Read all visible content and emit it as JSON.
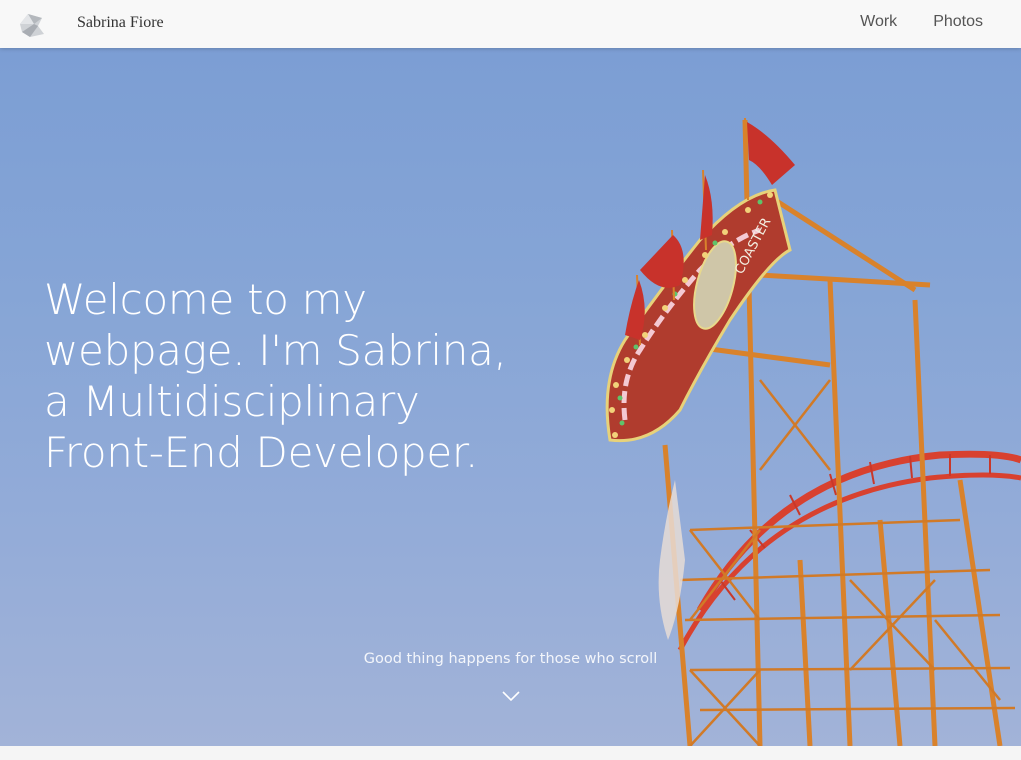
{
  "nav": {
    "brand": "Sabrina Fiore",
    "links": [
      {
        "label": "Work"
      },
      {
        "label": "Photos"
      }
    ]
  },
  "hero": {
    "headline": "Welcome to my webpage. I'm Sabrina, a Multidisciplinary Front-End Developer.",
    "scroll_hint": "Good thing happens for those who scroll",
    "sign_text": "COASTER"
  },
  "colors": {
    "sky": "#86a5d6",
    "structure": "#d9822b",
    "track": "#d8412f",
    "flag": "#c8322b"
  },
  "icons": {
    "logo": "crumpled-paper-icon",
    "scroll": "chevron-down-icon"
  }
}
